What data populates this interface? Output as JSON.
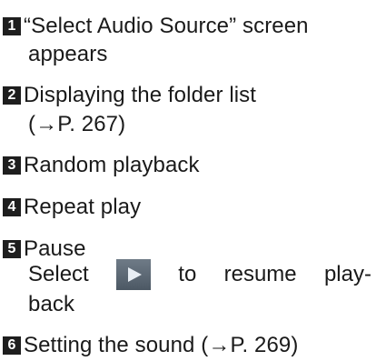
{
  "items": [
    {
      "number": "1",
      "lines": [
        "“Select Audio Source” screen",
        "appears"
      ]
    },
    {
      "number": "2",
      "lines": [
        "Displaying the folder list",
        "(→P. 267)"
      ]
    },
    {
      "number": "3",
      "lines": [
        "Random playback"
      ]
    },
    {
      "number": "4",
      "lines": [
        "Repeat play"
      ]
    },
    {
      "number": "5",
      "lines": [
        "Pause"
      ],
      "instruction": {
        "before_icon": "Select",
        "icon": "play-icon",
        "words_after_icon": [
          "to",
          "resume",
          "play-"
        ],
        "last_line": "back"
      }
    },
    {
      "number": "6",
      "lines": [
        "Setting the sound (→P. 269)"
      ]
    }
  ]
}
